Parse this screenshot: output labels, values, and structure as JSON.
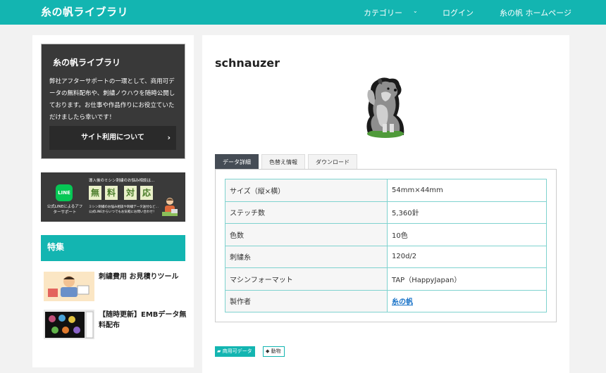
{
  "header": {
    "site_title": "糸の帆ライブラリ",
    "nav": {
      "category": "カテゴリー",
      "login": "ログイン",
      "home": "糸の帆 ホームページ"
    }
  },
  "sidebar": {
    "about": {
      "title": "糸の帆ライブラリ",
      "text": "弊社アフターサポートの一環として、商用可データの無料配布や、刺繍ノウハウを随時公開しております。お仕事や作品作りにお役立ていただけましたら幸いです！",
      "button_label": "サイト利用について"
    },
    "line_banner": {
      "headline": "導入後のミシン刺繍のお悩み相談は...",
      "caption": "公式LINEによるアフターサポート",
      "free_chars": [
        "無",
        "料",
        "対",
        "応"
      ],
      "footnote": "ミシン刺繍のお悩み相談や刺繍データ送付など…公式LINEからいつでもお気軽にお問い合わせ！",
      "line_label": "LINE"
    },
    "feature_title": "特集",
    "features": [
      {
        "title": "刺繍費用 お見積りツール"
      },
      {
        "title": "【随時更新】EMBデータ無料配布"
      }
    ]
  },
  "main": {
    "title": "schnauzer",
    "tabs": [
      {
        "label": "データ詳細",
        "active": true
      },
      {
        "label": "色替え情報",
        "active": false
      },
      {
        "label": "ダウンロード",
        "active": false
      }
    ],
    "specs": [
      {
        "key": "サイズ（縦×横）",
        "value": "54mm×44mm"
      },
      {
        "key": "ステッチ数",
        "value": "5,360針"
      },
      {
        "key": "色数",
        "value": "10色"
      },
      {
        "key": "刺繍糸",
        "value": "120d/2"
      },
      {
        "key": "マシンフォーマット",
        "value": "TAP（HappyJapan）"
      },
      {
        "key": "製作者",
        "value": "糸の帆"
      }
    ],
    "category_chip": "商用可データ",
    "tag_chip": "動物"
  },
  "colors": {
    "accent": "#13b5b1",
    "dark_panel": "#393939",
    "link": "#1a73c8"
  }
}
